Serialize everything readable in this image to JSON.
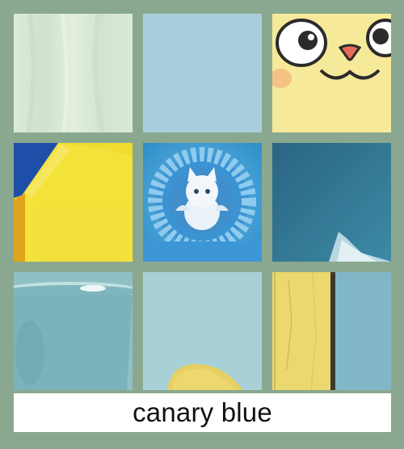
{
  "caption": "canary blue",
  "tiles": [
    {
      "name": "pale-green-fabric",
      "color": "#d8e8d4"
    },
    {
      "name": "light-blue-swatch",
      "color": "#a9cedb"
    },
    {
      "name": "yellow-cartoon-face",
      "color": "#f6ea9a"
    },
    {
      "name": "yellow-blue-painting",
      "color": "#f3e23a"
    },
    {
      "name": "white-cat-flower-wreath",
      "color": "#4da6d6"
    },
    {
      "name": "teal-wave",
      "color": "#2e6f86"
    },
    {
      "name": "teal-bowl",
      "color": "#7fb5bd"
    },
    {
      "name": "yellow-chair-on-blue",
      "color": "#a5cfd6"
    },
    {
      "name": "yellow-plank-on-blue",
      "color": "#7fb3c4"
    }
  ]
}
